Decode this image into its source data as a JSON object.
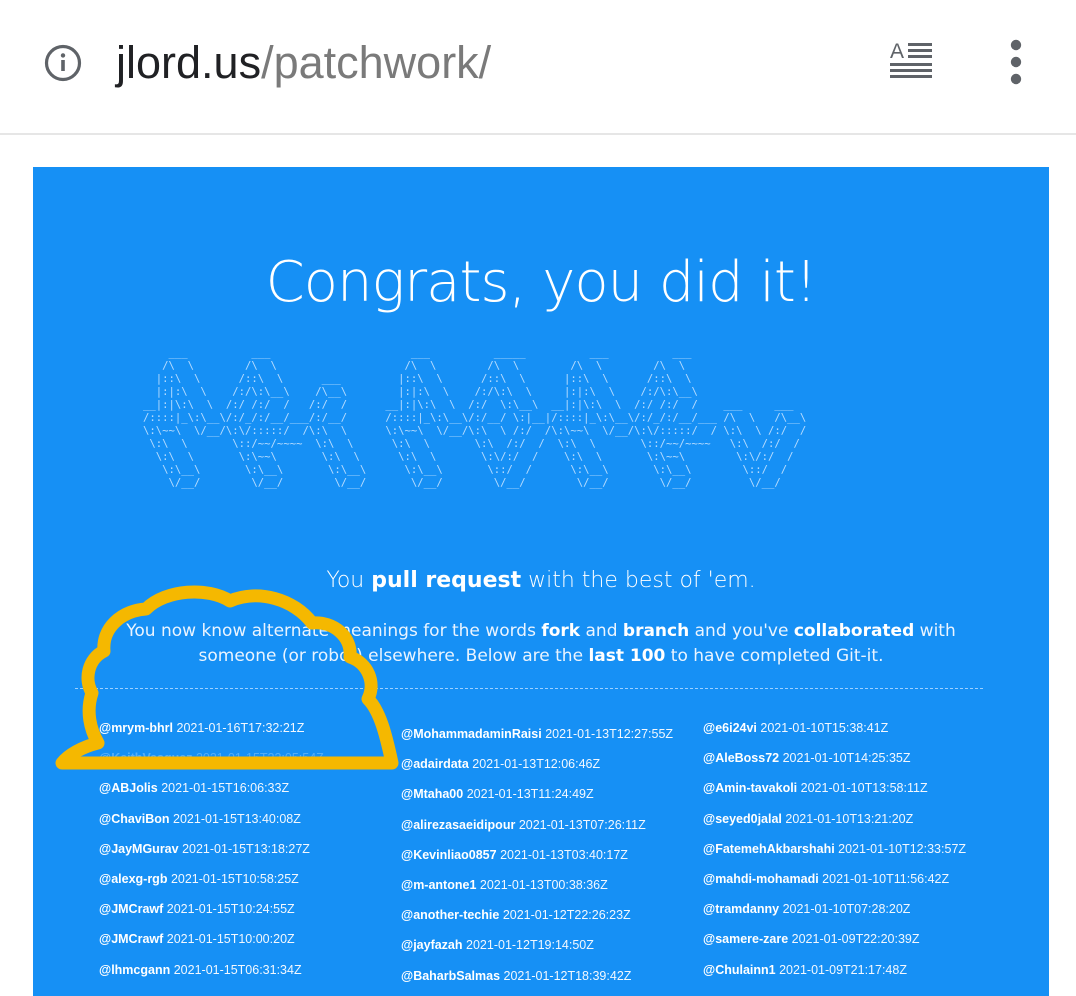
{
  "browser": {
    "url_host": "jlord.us",
    "url_path": "/patchwork/"
  },
  "page": {
    "heading": "Congrats, you did it!",
    "ascii_art": "    ___          ___                      ___          _____          ___          ___                      \n   /\\  \\        /\\  \\                    /\\  \\        /\\  \\        /\\  \\        /\\  \\                     \n  |::\\  \\      /::\\  \\      ___         |::\\  \\      /::\\  \\      |::\\  \\      /::\\  \\                    \n  |:|:\\  \\    /:/\\:\\__\\    /\\__\\        |:|:\\  \\    /:/\\:\\  \\     |:|:\\  \\    /:/\\:\\__\\                   \n__|:|\\:\\  \\  /:/ /:/  /   /:/  /      __|:|\\:\\  \\  /:/  \\:\\__\\  __|:|\\:\\  \\  /:/ /:/  /    ___     ___     \n/::::|_\\:\\__\\/:/_/:/__/___/:/__/      /::::|_\\:\\__\\/:/__/ \\:|__|/::::|_\\:\\__\\/:/_/:/__/___ /\\  \\   /\\__\\    \n\\:\\~~\\  \\/__/\\:\\/:::::/  /\\:\\  \\      \\:\\~~\\  \\/__/\\:\\  \\ /:/  /\\:\\~~\\  \\/__/\\:\\/:::::/  / \\:\\  \\ /:/  /   \n \\:\\  \\       \\::/~~/~~~~  \\:\\  \\      \\:\\  \\       \\:\\  /:/  /  \\:\\  \\       \\::/~~/~~~~   \\:\\  /:/  /    \n  \\:\\  \\       \\:\\~~\\       \\:\\  \\      \\:\\  \\       \\:\\/:/  /    \\:\\  \\       \\:\\~~\\        \\:\\/:/  /     \n   \\:\\__\\       \\:\\__\\       \\:\\__\\      \\:\\__\\       \\::/  /      \\:\\__\\       \\:\\__\\        \\::/  /      \n    \\/__/        \\/__/        \\/__/       \\/__/        \\/__/        \\/__/        \\/__/         \\/__/       ",
    "tagline": {
      "prefix": "You ",
      "bold": "pull request",
      "suffix": " with the best of 'em."
    },
    "description": {
      "p1": "You now know alternate meanings for the words ",
      "b1": "fork",
      "p2": " and ",
      "b2": "branch",
      "p3": " and you've ",
      "b3": "collaborated",
      "p4": " with someone (or robot) elsewhere. Below are the ",
      "b4": "last 100",
      "p5": " to have completed Git-it."
    },
    "completions": {
      "col1": [
        {
          "user": "@mrym-bhrl",
          "ts": "2021-01-16T17:32:21Z"
        },
        {
          "user": "@KeithVasquez",
          "ts": "2021-01-15T23:05:54Z"
        },
        {
          "user": "@ABJolis",
          "ts": "2021-01-15T16:06:33Z"
        },
        {
          "user": "@ChaviBon",
          "ts": "2021-01-15T13:40:08Z"
        },
        {
          "user": "@JayMGurav",
          "ts": "2021-01-15T13:18:27Z"
        },
        {
          "user": "@alexg-rgb",
          "ts": "2021-01-15T10:58:25Z"
        },
        {
          "user": "@JMCrawf",
          "ts": "2021-01-15T10:24:55Z"
        },
        {
          "user": "@JMCrawf",
          "ts": "2021-01-15T10:00:20Z"
        },
        {
          "user": "@lhmcgann",
          "ts": "2021-01-15T06:31:34Z"
        }
      ],
      "col2": [
        {
          "user": "@MohammadaminRaisi",
          "ts": "2021-01-13T12:27:55Z"
        },
        {
          "user": "@adairdata",
          "ts": "2021-01-13T12:06:46Z"
        },
        {
          "user": "@Mtaha00",
          "ts": "2021-01-13T11:24:49Z"
        },
        {
          "user": "@alirezasaeidipour",
          "ts": "2021-01-13T07:26:11Z"
        },
        {
          "user": "@Kevinliao0857",
          "ts": "2021-01-13T03:40:17Z"
        },
        {
          "user": "@m-antone1",
          "ts": "2021-01-13T00:38:36Z"
        },
        {
          "user": "@another-techie",
          "ts": "2021-01-12T22:26:23Z"
        },
        {
          "user": "@jayfazah",
          "ts": "2021-01-12T19:14:50Z"
        },
        {
          "user": "@BaharbSalmas",
          "ts": "2021-01-12T18:39:42Z"
        }
      ],
      "col3": [
        {
          "user": "@e6i24vi",
          "ts": "2021-01-10T15:38:41Z"
        },
        {
          "user": "@AleBoss72",
          "ts": "2021-01-10T14:25:35Z"
        },
        {
          "user": "@Amin-tavakoli",
          "ts": "2021-01-10T13:58:11Z"
        },
        {
          "user": "@seyed0jalal",
          "ts": "2021-01-10T13:21:20Z"
        },
        {
          "user": "@FatemehAkbarshahi",
          "ts": "2021-01-10T12:33:57Z"
        },
        {
          "user": "@mahdi-mohamadi",
          "ts": "2021-01-10T11:56:42Z"
        },
        {
          "user": "@tramdanny",
          "ts": "2021-01-10T07:28:20Z"
        },
        {
          "user": "@samere-zare",
          "ts": "2021-01-09T22:20:39Z"
        },
        {
          "user": "@Chulainn1",
          "ts": "2021-01-09T21:17:48Z"
        }
      ]
    }
  },
  "colors": {
    "panel": "#1690f5",
    "annotation": "#f5b800"
  },
  "icons": {
    "info": "info-icon",
    "reader": "reader-mode-icon",
    "menu": "more-vert-icon",
    "annotation": "cloud-outline-annotation"
  }
}
